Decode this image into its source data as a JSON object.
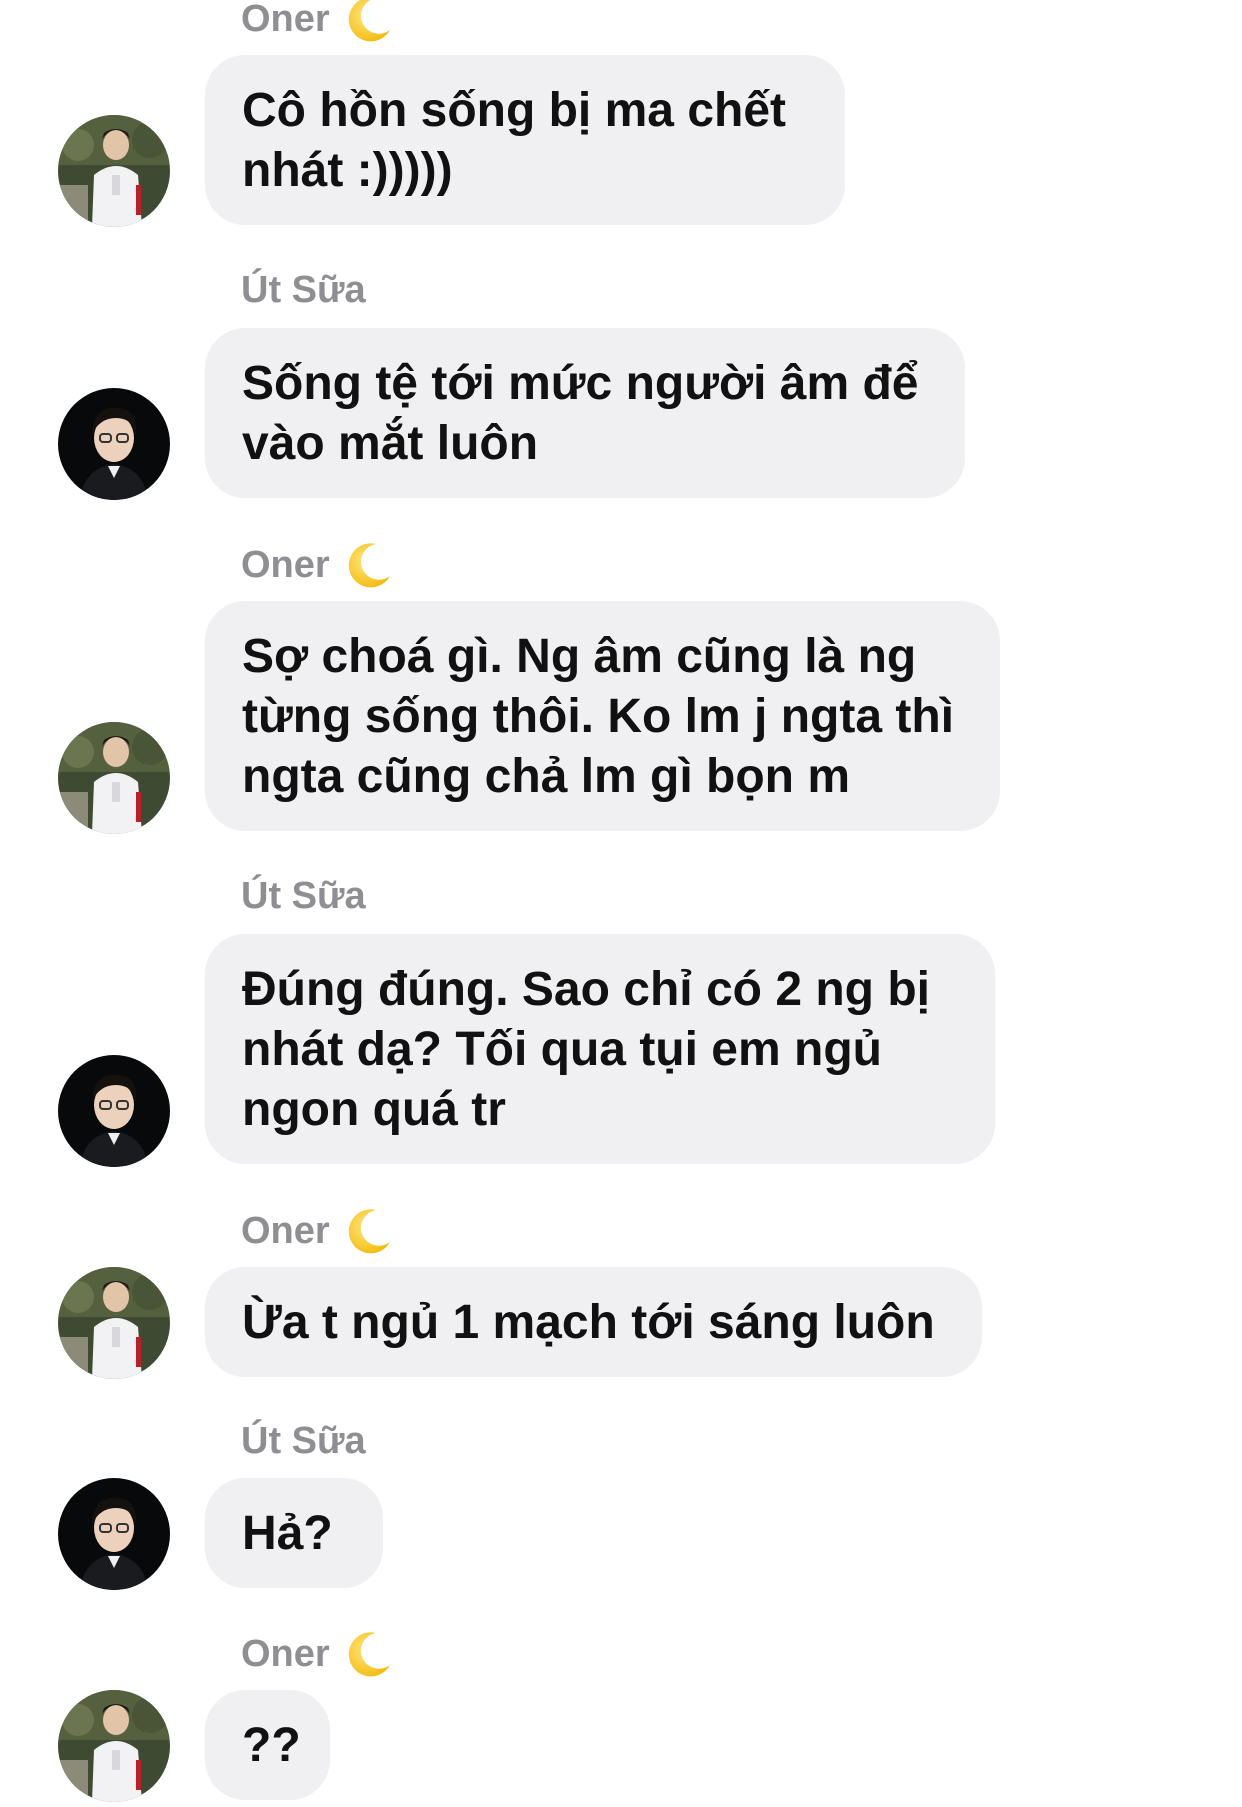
{
  "conversation": {
    "messages": [
      {
        "sender": "Oner",
        "sender_emoji": "crescent-moon-icon",
        "avatar": "avatar-oner",
        "lines": [
          "Cô hồn sống bị ma chết",
          "nhát :)))))"
        ]
      },
      {
        "sender": "Út Sữa",
        "sender_emoji": "",
        "avatar": "avatar-ut-sua",
        "lines": [
          "Sống tệ tới mức người âm để",
          "vào mắt luôn"
        ]
      },
      {
        "sender": "Oner",
        "sender_emoji": "crescent-moon-icon",
        "avatar": "avatar-oner",
        "lines": [
          "Sợ choá gì. Ng âm cũng là ng",
          "từng sống thôi. Ko lm j ngta thì",
          "ngta cũng chả lm gì bọn m"
        ]
      },
      {
        "sender": "Út Sữa",
        "sender_emoji": "",
        "avatar": "avatar-ut-sua",
        "lines": [
          "Đúng đúng. Sao chỉ có 2 ng bị",
          "nhát dạ? Tối qua tụi em ngủ",
          "ngon quá tr"
        ]
      },
      {
        "sender": "Oner",
        "sender_emoji": "crescent-moon-icon",
        "avatar": "avatar-oner",
        "lines": [
          "Ừa t ngủ 1 mạch tới sáng luôn"
        ]
      },
      {
        "sender": "Út Sữa",
        "sender_emoji": "",
        "avatar": "avatar-ut-sua",
        "lines": [
          "Hả?"
        ]
      },
      {
        "sender": "Oner",
        "sender_emoji": "crescent-moon-icon",
        "avatar": "avatar-oner",
        "lines": [
          "??"
        ]
      }
    ]
  },
  "colors": {
    "bubble_background": "#f0f0f2",
    "sender_name": "#8e8e93",
    "message_text": "#111111",
    "moon": "#f5c518"
  }
}
